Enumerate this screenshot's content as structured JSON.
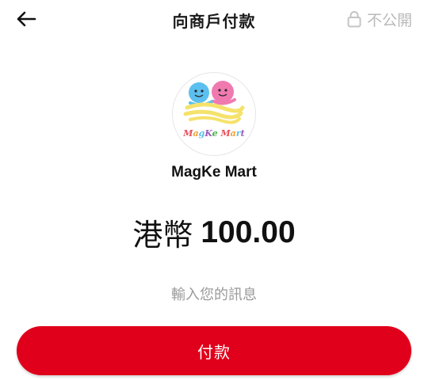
{
  "header": {
    "back_icon": "arrow-left-icon",
    "title": "向商戶付款",
    "privacy_icon": "lock-icon",
    "privacy_label": "不公開"
  },
  "merchant": {
    "name": "MagKe Mart",
    "logo_text": "MagKe Mart"
  },
  "payment": {
    "currency": "港幣",
    "amount": "100.00"
  },
  "message": {
    "placeholder": "輸入您的訊息",
    "value": ""
  },
  "actions": {
    "pay_label": "付款"
  },
  "colors": {
    "accent": "#e0001b",
    "muted_text": "#9a9a9a",
    "privacy_text": "#b9b9b9"
  }
}
